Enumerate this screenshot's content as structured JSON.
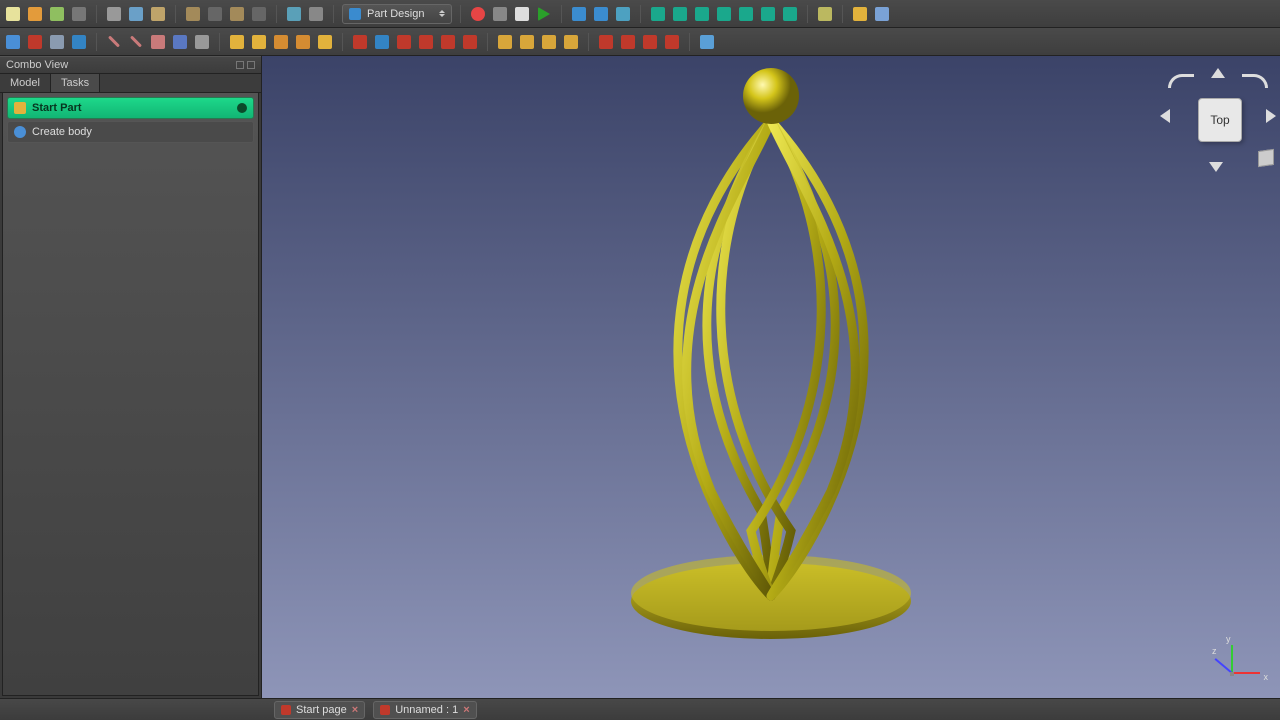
{
  "workbench": {
    "selected": "Part Design"
  },
  "toolbar1": {
    "icons": [
      {
        "n": "new-file-icon",
        "c": "#e7e29c"
      },
      {
        "n": "open-icon",
        "c": "#e39b3b"
      },
      {
        "n": "save-icon",
        "c": "#8fbf60"
      },
      {
        "n": "print-icon",
        "c": "#777"
      },
      {
        "n": "cut-icon",
        "c": "#999"
      },
      {
        "n": "copy-icon",
        "c": "#6aa0c8"
      },
      {
        "n": "paste-icon",
        "c": "#bfa46a"
      },
      {
        "n": "undo-icon",
        "c": "#a38a5a"
      },
      {
        "n": "undo-menu-icon",
        "c": "#666"
      },
      {
        "n": "redo-icon",
        "c": "#a38a5a"
      },
      {
        "n": "redo-menu-icon",
        "c": "#666"
      },
      {
        "n": "refresh-icon",
        "c": "#5aa0b8"
      },
      {
        "n": "whats-this-icon",
        "c": "#888"
      }
    ],
    "right_icons": [
      {
        "n": "record-icon",
        "c": "#e64545",
        "round": true
      },
      {
        "n": "stop-icon",
        "c": "#888"
      },
      {
        "n": "edit-macro-icon",
        "c": "#ddd"
      },
      {
        "n": "play-icon",
        "c": "#2aa02a",
        "tri": true
      },
      {
        "n": "fit-all-icon",
        "c": "#3b8ccf"
      },
      {
        "n": "fit-sel-icon",
        "c": "#3b8ccf"
      },
      {
        "n": "draw-style-icon",
        "c": "#4da1c1"
      },
      {
        "n": "iso-icon",
        "c": "#1aa88c"
      },
      {
        "n": "front-icon",
        "c": "#1aa88c"
      },
      {
        "n": "top-icon",
        "c": "#1aa88c"
      },
      {
        "n": "right-icon",
        "c": "#1aa88c"
      },
      {
        "n": "rear-icon",
        "c": "#1aa88c"
      },
      {
        "n": "bottom-icon",
        "c": "#1aa88c"
      },
      {
        "n": "left-icon",
        "c": "#1aa88c"
      },
      {
        "n": "measure-icon",
        "c": "#bbb860"
      },
      {
        "n": "part-icon",
        "c": "#e2b23c"
      },
      {
        "n": "group-icon",
        "c": "#7aa2d6"
      }
    ]
  },
  "toolbar2": {
    "icons": [
      {
        "n": "link-icon",
        "c": "#4a8fd6"
      },
      {
        "n": "link-sub-icon",
        "c": "#c0392b"
      },
      {
        "n": "import-icon",
        "c": "#8a9bb0"
      },
      {
        "n": "link-group-icon",
        "c": "#3384c4"
      },
      {
        "n": "line-icon",
        "c": "#c97a7a",
        "thin": true
      },
      {
        "n": "line2-icon",
        "c": "#c97a7a",
        "thin": true
      },
      {
        "n": "plane-icon",
        "c": "#c97a7a"
      },
      {
        "n": "cs-icon",
        "c": "#5a78c2"
      },
      {
        "n": "shapebinder-icon",
        "c": "#999"
      },
      {
        "n": "pad-icon",
        "c": "#e2b23c"
      },
      {
        "n": "revolve-icon",
        "c": "#e2b23c"
      },
      {
        "n": "loft-icon",
        "c": "#d58c32"
      },
      {
        "n": "sweep-icon",
        "c": "#d58c32"
      },
      {
        "n": "helix-icon",
        "c": "#e2b23c"
      },
      {
        "n": "pocket-icon",
        "c": "#c0392b"
      },
      {
        "n": "hole-icon",
        "c": "#3384c4"
      },
      {
        "n": "groove-icon",
        "c": "#c0392b"
      },
      {
        "n": "sub-loft-icon",
        "c": "#c0392b"
      },
      {
        "n": "sub-sweep-icon",
        "c": "#c0392b"
      },
      {
        "n": "sub-helix-icon",
        "c": "#c0392b"
      },
      {
        "n": "fillet-icon",
        "c": "#d8a63a"
      },
      {
        "n": "chamfer-icon",
        "c": "#d8a63a"
      },
      {
        "n": "draft-icon",
        "c": "#d8a63a"
      },
      {
        "n": "thickness-icon",
        "c": "#d8a63a"
      },
      {
        "n": "mirror-icon",
        "c": "#c0392b"
      },
      {
        "n": "linear-icon",
        "c": "#c0392b"
      },
      {
        "n": "polar-icon",
        "c": "#c0392b"
      },
      {
        "n": "multi-icon",
        "c": "#c0392b"
      },
      {
        "n": "boolean-icon",
        "c": "#5a9fd6"
      }
    ]
  },
  "comboView": {
    "title": "Combo View",
    "tabs": [
      "Model",
      "Tasks"
    ],
    "activeTab": 1,
    "tasks": [
      {
        "label": "Start Part",
        "primary": true
      },
      {
        "label": "Create body",
        "primary": false
      }
    ]
  },
  "navCube": {
    "face": "Top"
  },
  "axes": {
    "x": "x",
    "y": "y",
    "z": "z"
  },
  "documents": [
    {
      "label": "Start page"
    },
    {
      "label": "Unnamed : 1"
    }
  ]
}
